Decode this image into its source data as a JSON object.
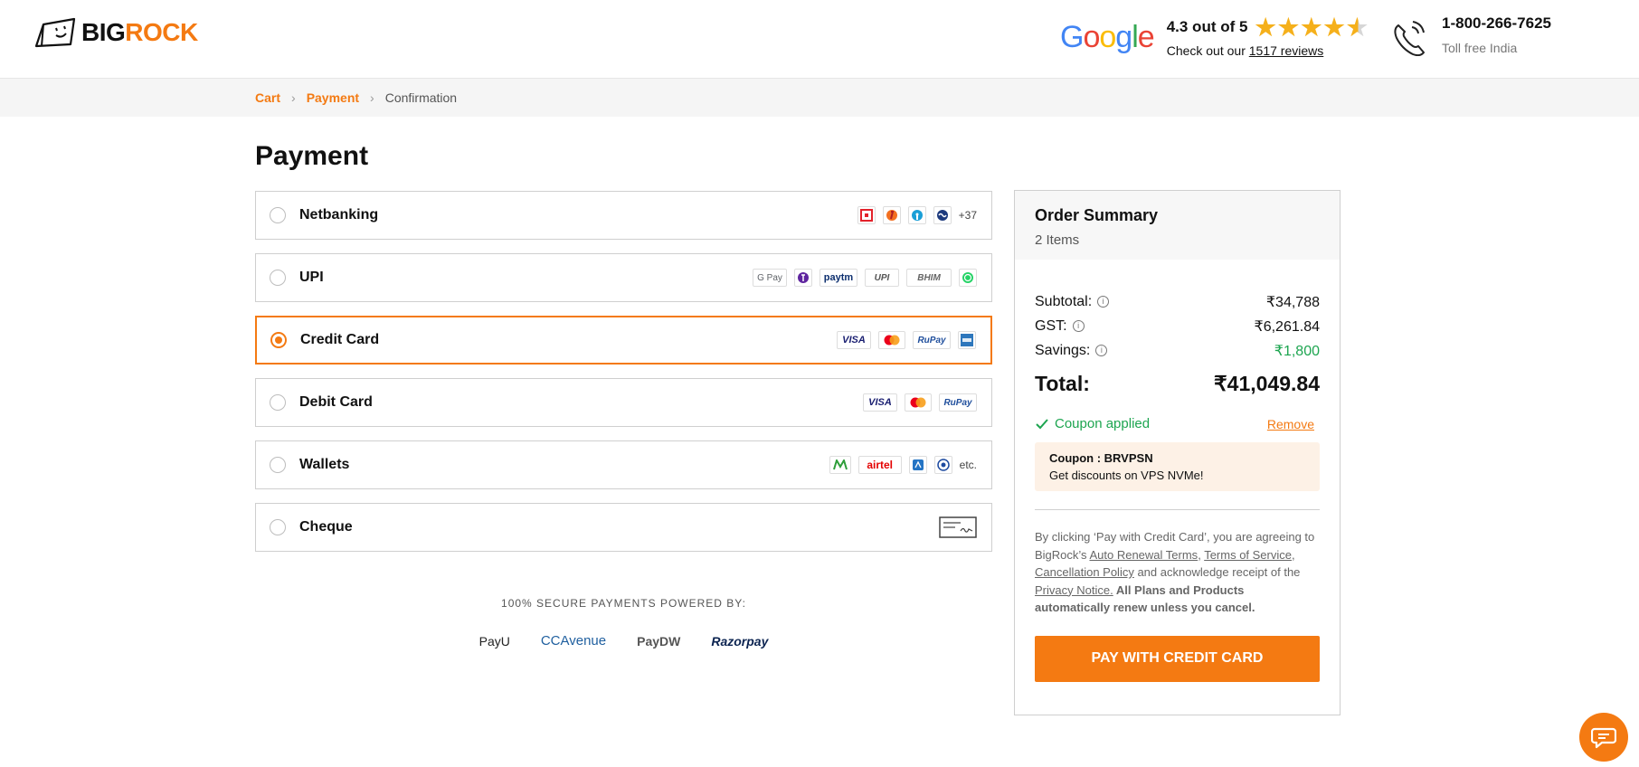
{
  "header": {
    "logo": {
      "big": "BIG",
      "rock": "ROCK"
    },
    "google": {
      "letters": [
        "G",
        "o",
        "o",
        "g",
        "l",
        "e"
      ],
      "rating_text": "4.3 out of 5",
      "reviews_prefix": "Check out our ",
      "reviews_link": "1517 reviews"
    },
    "phone": {
      "number": "1-800-266-7625",
      "sub": "Toll free India"
    }
  },
  "breadcrumb": {
    "cart": "Cart",
    "payment": "Payment",
    "confirmation": "Confirmation"
  },
  "page_title": "Payment",
  "methods": [
    {
      "label": "Netbanking",
      "extra": "+37"
    },
    {
      "label": "UPI"
    },
    {
      "label": "Credit Card"
    },
    {
      "label": "Debit Card"
    },
    {
      "label": "Wallets",
      "extra": "etc."
    },
    {
      "label": "Cheque"
    }
  ],
  "logos": {
    "gpay": "G Pay",
    "paytm": "paytm",
    "upi": "UPI",
    "bhim": "BHIM",
    "visa": "VISA",
    "rupay": "RuPay",
    "airtel": "airtel"
  },
  "secure_label": "100% SECURE PAYMENTS POWERED BY:",
  "gateways": [
    "PayU",
    "CCAvenue",
    "PayDW",
    "Razorpay"
  ],
  "summary": {
    "title": "Order Summary",
    "items": "2 Items",
    "subtotal_label": "Subtotal:",
    "subtotal_value": "₹34,788",
    "gst_label": "GST:",
    "gst_value": "₹6,261.84",
    "savings_label": "Savings:",
    "savings_value": "₹1,800",
    "total_label": "Total:",
    "total_value": "₹41,049.84",
    "coupon_applied": "Coupon applied",
    "remove": "Remove",
    "coupon_code": "Coupon : BRVPSN",
    "coupon_desc": "Get discounts on VPS NVMe!",
    "terms": {
      "t1": "By clicking ‘Pay with Credit Card’, you are agreeing to BigRock’s ",
      "auto_renewal": "Auto Renewal Terms",
      "comma1": ", ",
      "tos": "Terms of Service",
      "comma2": ", ",
      "cancellation": "Cancellation Policy",
      "t2": " and acknowledge receipt of the ",
      "privacy": "Privacy Notice.",
      "bold": " All Plans and Products automatically renew unless you cancel."
    },
    "pay_button": "PAY WITH CREDIT CARD"
  },
  "colors": {
    "brand": "#f47a12",
    "success": "#1da550"
  },
  "icons": {
    "chat": "chat-icon",
    "phone": "phone-icon",
    "info": "info-icon",
    "check": "check-icon"
  }
}
